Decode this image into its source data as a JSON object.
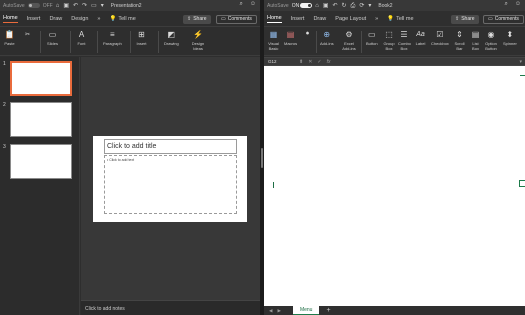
{
  "powerpoint": {
    "titlebar": {
      "autosave_label": "AutoSave",
      "autosave_state": "OFF",
      "doc_title": "Presentation2"
    },
    "tabs": [
      "Home",
      "Insert",
      "Draw",
      "Design"
    ],
    "more_tabs": "»",
    "tell_me": "Tell me",
    "share": "Share",
    "comments": "Comments",
    "ribbon": {
      "paste": "Paste",
      "slides": "Slides",
      "font": "Font",
      "paragraph": "Paragraph",
      "insert": "Insert",
      "drawing": "Drawing",
      "design_ideas": "Design Ideas"
    },
    "slide_numbers": [
      "1",
      "2",
      "3"
    ],
    "slide": {
      "title_placeholder": "Click to add title",
      "body_placeholder": "• Click to add text"
    },
    "notes": "Click to add notes"
  },
  "excel": {
    "titlebar": {
      "autosave_label": "AutoSave",
      "autosave_state": "ON",
      "doc_title": "Book2"
    },
    "tabs": [
      "Home",
      "Insert",
      "Draw",
      "Page Layout"
    ],
    "more_tabs": "»",
    "tell_me": "Tell me",
    "share": "Share",
    "comments": "Comments",
    "ribbon": {
      "visual_basic": "Visual Basic",
      "macros": "Macros",
      "addins": "Add-ins",
      "excel_addins": "Excel Add-ins",
      "button": "Button",
      "group_box": "Group Box",
      "combo_box": "Combo Box",
      "label": "Label",
      "checkbox": "Checkbox",
      "scroll_bar": "Scroll Bar",
      "list_box": "List Box",
      "option_button": "Option Button",
      "spinner": "Spinner"
    },
    "name_box": "G12",
    "fx": "fx",
    "sheet_tab": "Menu",
    "add_sheet": "+"
  },
  "colors": {
    "ppt_accent": "#e96b3c",
    "excel_accent": "#1e7a4a"
  }
}
